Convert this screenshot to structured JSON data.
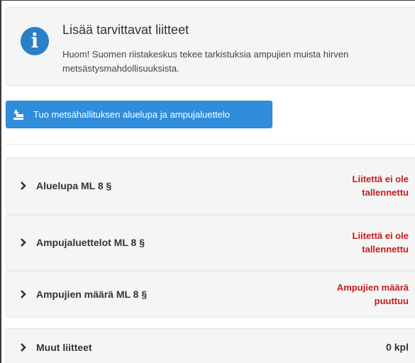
{
  "info": {
    "title": "Lisää tarvittavat liitteet",
    "text": "Huom! Suomen riistakeskus tekee tarkistuksia ampujien muista hirven metsästysmahdollisuuksista.",
    "icon": "info-icon",
    "icon_color": "#2a7fc6"
  },
  "import_button": {
    "label": "Tuo metsähallituksen aluelupa ja ampujaluettelo",
    "icon": "import-icon",
    "color": "#2f8ddc"
  },
  "sections": [
    {
      "title": "Aluelupa ML 8 §",
      "status": "Liitettä ei ole tallennettu",
      "status_type": "missing"
    },
    {
      "title": "Ampujaluettelot ML 8 §",
      "status": "Liitettä ei ole tallennettu",
      "status_type": "missing"
    },
    {
      "title": "Ampujien määrä ML 8 §",
      "status": "Ampujien määrä puuttuu",
      "status_type": "missing"
    },
    {
      "title": "Muut liitteet",
      "status": "0 kpl",
      "status_type": "ok"
    }
  ],
  "colors": {
    "missing_text": "#c41d1d",
    "panel_bg": "#f5f5f5"
  }
}
